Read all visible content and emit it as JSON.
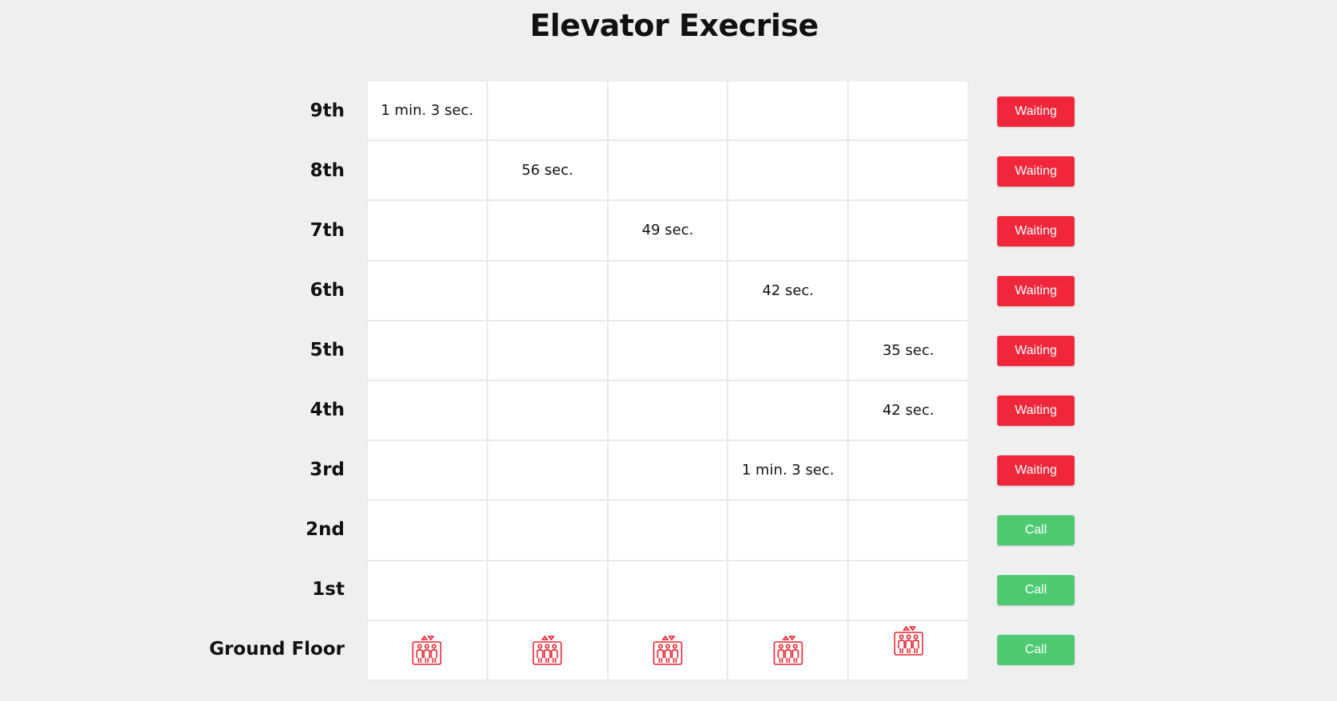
{
  "title": "Elevator Execrise",
  "colors": {
    "waiting": "#f0263a",
    "call": "#4fca72",
    "elevator_icon": "#e8232f",
    "background": "#efefef"
  },
  "floors": [
    {
      "label": "9th",
      "button": "Waiting",
      "state": "waiting",
      "cells": [
        "1 min. 3 sec.",
        "",
        "",
        "",
        ""
      ]
    },
    {
      "label": "8th",
      "button": "Waiting",
      "state": "waiting",
      "cells": [
        "",
        "56 sec.",
        "",
        "",
        ""
      ]
    },
    {
      "label": "7th",
      "button": "Waiting",
      "state": "waiting",
      "cells": [
        "",
        "",
        "49 sec.",
        "",
        ""
      ]
    },
    {
      "label": "6th",
      "button": "Waiting",
      "state": "waiting",
      "cells": [
        "",
        "",
        "",
        "42 sec.",
        ""
      ]
    },
    {
      "label": "5th",
      "button": "Waiting",
      "state": "waiting",
      "cells": [
        "",
        "",
        "",
        "",
        "35 sec."
      ]
    },
    {
      "label": "4th",
      "button": "Waiting",
      "state": "waiting",
      "cells": [
        "",
        "",
        "",
        "",
        "42 sec."
      ]
    },
    {
      "label": "3rd",
      "button": "Waiting",
      "state": "waiting",
      "cells": [
        "",
        "",
        "",
        "1 min. 3 sec.",
        ""
      ]
    },
    {
      "label": "2nd",
      "button": "Call",
      "state": "call",
      "cells": [
        "",
        "",
        "",
        "",
        ""
      ]
    },
    {
      "label": "1st",
      "button": "Call",
      "state": "call",
      "cells": [
        "",
        "",
        "",
        "",
        ""
      ]
    },
    {
      "label": "Ground Floor",
      "button": "Call",
      "state": "call",
      "cells": [
        "elevator-icon",
        "elevator-icon",
        "elevator-icon",
        "elevator-icon",
        "elevator-icon"
      ]
    }
  ]
}
